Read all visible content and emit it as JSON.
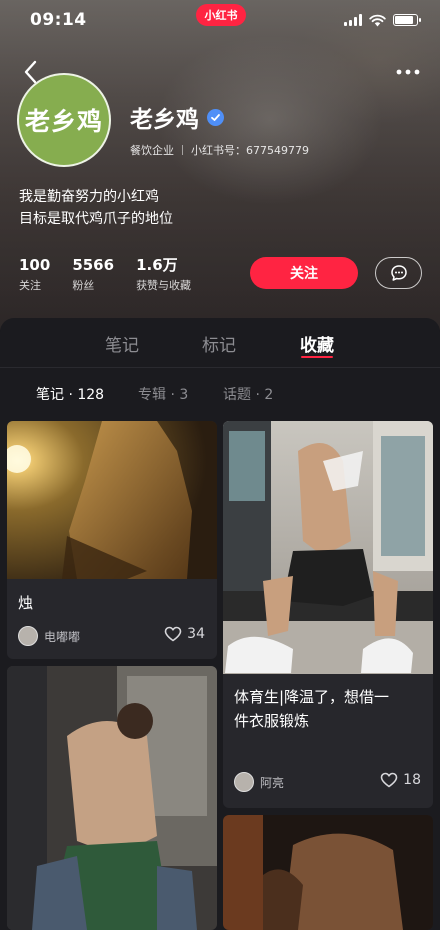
{
  "status_bar": {
    "time": "09:14",
    "brand": "小红书"
  },
  "profile": {
    "avatar_text": "老乡鸡",
    "name": "老乡鸡",
    "category": "餐饮企业",
    "red_id": "小红书号：677549779",
    "bio_line1": "我是勤奋努力的小红鸡",
    "bio_line2": "目标是取代鸡爪子的地位",
    "stats": [
      {
        "value": "100",
        "label": "关注"
      },
      {
        "value": "5566",
        "label": "粉丝"
      },
      {
        "value": "1.6万",
        "label": "获赞与收藏"
      }
    ],
    "follow_label": "关注"
  },
  "tabs": [
    {
      "label": "笔记"
    },
    {
      "label": "标记"
    },
    {
      "label": "收藏",
      "active": true
    }
  ],
  "subtabs": [
    {
      "label": "笔记 · 128",
      "active": true
    },
    {
      "label": "专辑 · 3"
    },
    {
      "label": "话题 · 2"
    }
  ],
  "cards": [
    {
      "title": "烛",
      "user": "电嘟嘟",
      "likes": "34"
    },
    {
      "title_line1": "体育生|降温了，想借一",
      "title_line2": "件衣服锻炼",
      "user": "阿亮",
      "likes": "18"
    }
  ],
  "colors": {
    "accent": "#ff2442",
    "avatar_bg": "#86ad4f",
    "verified": "#4f8ff7",
    "sheet_bg": "#1b1b1f",
    "card_bg": "#27272c"
  },
  "icons": [
    "back-icon",
    "more-icon",
    "verified-icon",
    "message-icon",
    "heart-icon",
    "signal-icon",
    "wifi-icon",
    "battery-icon"
  ]
}
